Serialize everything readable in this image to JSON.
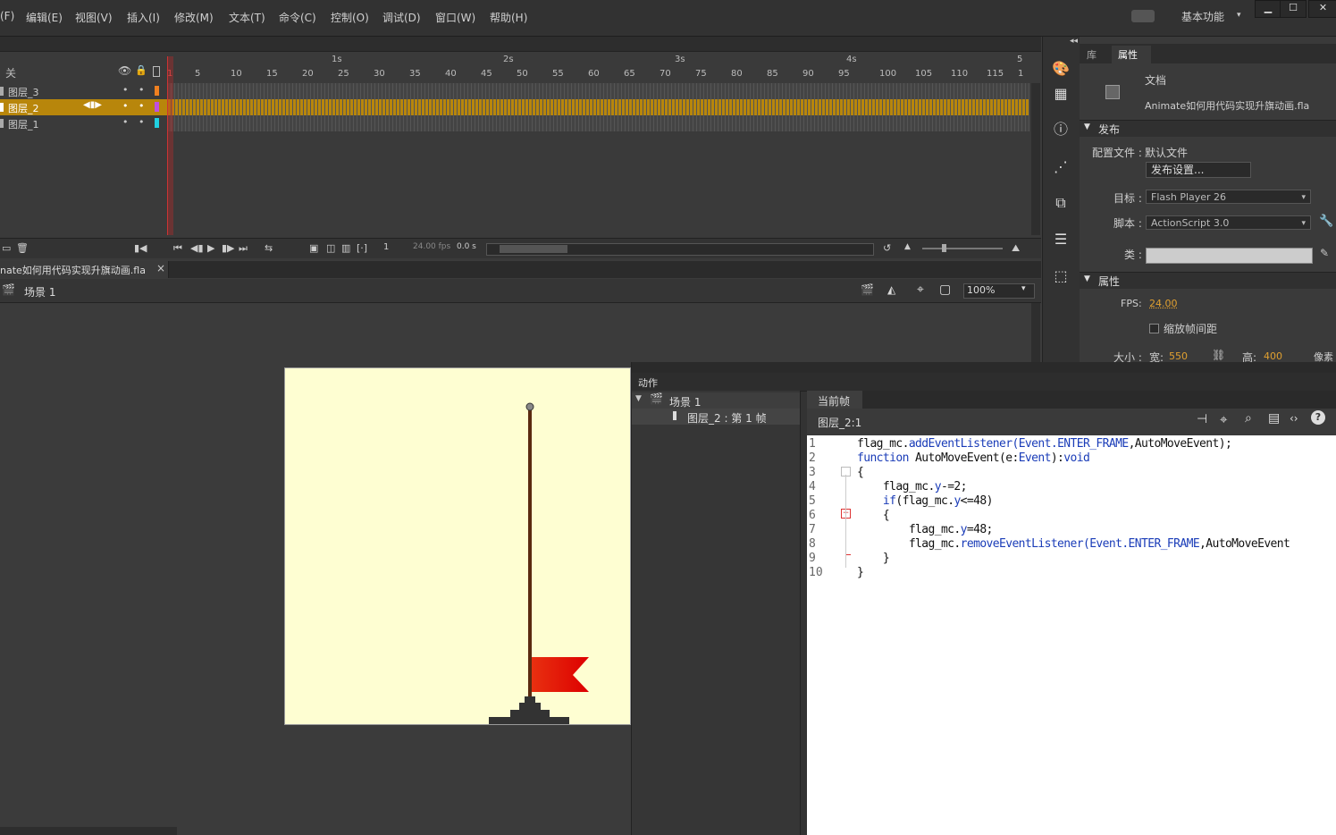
{
  "menubar": {
    "items": [
      "(F)",
      "编辑(E)",
      "视图(V)",
      "插入(I)",
      "修改(M)",
      "文本(T)",
      "命令(C)",
      "控制(O)",
      "调试(D)",
      "窗口(W)",
      "帮助(H)"
    ],
    "workspace": "基本功能",
    "win_min": "▁",
    "win_max": "☐",
    "win_close": "✕"
  },
  "timeline": {
    "header_label": "关",
    "seconds": [
      "1s",
      "2s",
      "3s",
      "4s",
      "5"
    ],
    "frame_numbers": [
      "1",
      "5",
      "10",
      "15",
      "20",
      "25",
      "30",
      "35",
      "40",
      "45",
      "50",
      "55",
      "60",
      "65",
      "70",
      "75",
      "80",
      "85",
      "90",
      "95",
      "100",
      "105",
      "110",
      "115",
      "1"
    ],
    "layers": [
      {
        "name": "图层_3",
        "color": "#f08020",
        "selected": false
      },
      {
        "name": "图层_2",
        "color": "#c050e0",
        "selected": true
      },
      {
        "name": "图层_1",
        "color": "#20d0e0",
        "selected": false
      }
    ],
    "current_frame": "1",
    "fps": "24.00 fps",
    "time": "0.0 s"
  },
  "document": {
    "tab_title": "nate如何用代码实现升旗动画.fla",
    "close": "×",
    "scene": "场景 1",
    "zoom": "100%"
  },
  "properties": {
    "tab_library": "库",
    "tab_properties": "属性",
    "doc_label": "文档",
    "filename": "Animate如何用代码实现升旗动画.fla",
    "publish_section": "发布",
    "profile_label": "配置文件 :",
    "profile_value": "默认文件",
    "publish_settings_btn": "发布设置...",
    "target_label": "目标 :",
    "target_value": "Flash Player 26",
    "script_label": "脚本 :",
    "script_value": "ActionScript 3.0",
    "class_label": "类 :",
    "attrs_section": "属性",
    "fps_label": "FPS:",
    "fps_value": "24.00",
    "scale_spacing": "缩放帧间距",
    "size_label": "大小 :",
    "width_label": "宽:",
    "width_value": "550",
    "height_label": "高:",
    "height_value": "400",
    "unit": "像素"
  },
  "actions": {
    "panel_title": "动作",
    "tree_scene": "场景 1",
    "tree_frame": "图层_2 : 第 1 帧",
    "tab_current": "当前帧",
    "location": "图层_2:1",
    "line_numbers": [
      "1",
      "2",
      "3",
      "4",
      "5",
      "6",
      "7",
      "8",
      "9",
      "10"
    ],
    "code_lines": [
      [
        "flag_mc.",
        "addEventListener",
        "(",
        "Event.ENTER_FRAME",
        ",AutoMoveEvent);"
      ],
      [
        "function",
        " AutoMoveEvent(e:",
        "Event",
        "):",
        "void"
      ],
      [
        "{"
      ],
      [
        "    flag_mc.",
        "y",
        "-=2;"
      ],
      [
        "    ",
        "if",
        "(flag_mc.",
        "y",
        "<=48)"
      ],
      [
        "    {"
      ],
      [
        "        flag_mc.",
        "y",
        "=48;"
      ],
      [
        "        flag_mc.",
        "removeEventListener",
        "(",
        "Event.ENTER_FRAME",
        ",AutoMoveEvent"
      ],
      [
        "    }"
      ],
      [
        "}"
      ]
    ]
  },
  "colors": {
    "stage": "#fefed2",
    "flag": "#e01010",
    "pole": "#5a2a10",
    "selected_layer": "#b8860b",
    "playhead": "#cc3333"
  }
}
